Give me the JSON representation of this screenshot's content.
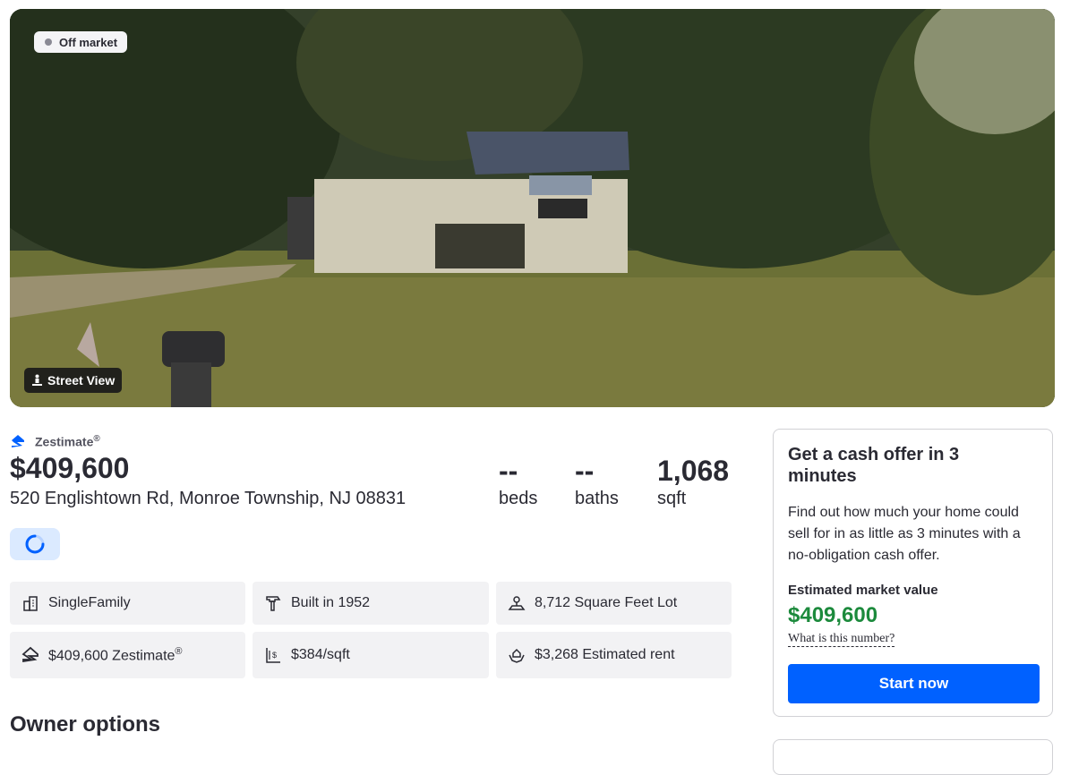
{
  "hero": {
    "badge": "Off market",
    "street_view_label": "Street View"
  },
  "summary": {
    "zestimate_label": "Zestimate",
    "zestimate_mark": "®",
    "price": "$409,600",
    "address": "520 Englishtown Rd, Monroe Township, NJ 08831",
    "beds_value": "--",
    "beds_label": "beds",
    "baths_value": "--",
    "baths_label": "baths",
    "sqft_value": "1,068",
    "sqft_label": "sqft"
  },
  "facts": [
    {
      "icon": "building-icon",
      "text": "SingleFamily"
    },
    {
      "icon": "hammer-icon",
      "text": "Built in 1952"
    },
    {
      "icon": "lot-size-icon",
      "text": "8,712 Square Feet Lot"
    },
    {
      "icon": "zestimate-logo-icon",
      "text": "$409,600 Zestimate",
      "mark": "®"
    },
    {
      "icon": "price-per-sqft-icon",
      "text": "$384/sqft"
    },
    {
      "icon": "rent-hands-icon",
      "text": "$3,268 Estimated rent"
    }
  ],
  "owner_options": {
    "heading": "Owner options"
  },
  "cash_offer": {
    "title": "Get a cash offer in 3 minutes",
    "description": "Find out how much your home could sell for in as little as 3 minutes with a no-obligation cash offer.",
    "estimate_label": "Estimated market value",
    "estimate_value": "$409,600",
    "what_link": "What is this number?",
    "button": "Start now"
  },
  "colors": {
    "accent": "#0061ff",
    "value_green": "#1c8a3c",
    "fact_bg": "#f2f2f4"
  }
}
